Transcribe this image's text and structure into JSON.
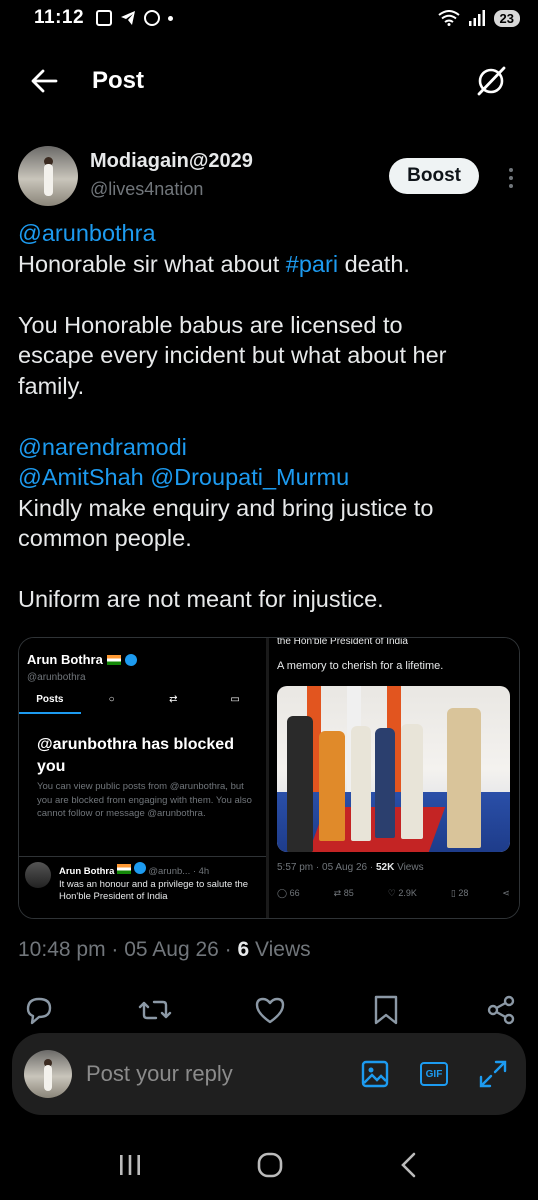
{
  "status_bar": {
    "time": "11:12",
    "battery": "23"
  },
  "header": {
    "title": "Post"
  },
  "post": {
    "display_name": "Modiagain@2029",
    "handle": "@lives4nation",
    "boost_label": "Boost",
    "text": {
      "mention_1": "@arunbothra",
      "line2_pre": "Honorable sir what about ",
      "line2_tag": "#pari",
      "line2_post": " death.",
      "line3": "You Honorable babus are licensed to",
      "line4": "escape every incident but what about her",
      "line5": "family.",
      "mention_2": "@narendramodi",
      "mention_3": "@AmitShah",
      "mention_4": "@Droupati_Murmu",
      "line8": "Kindly make enquiry and bring justice to",
      "line9": "common people.",
      "line10": "Uniform are not meant for injustice."
    },
    "timestamp": "10:48 pm · 05 Aug 26 · ",
    "views_count": "6",
    "views_label": " Views"
  },
  "media": {
    "left": {
      "name": "Arun Bothra",
      "handle": "@arunbothra",
      "tab_posts": "Posts",
      "blocked_title": "@arunbothra has blocked you",
      "blocked_text": "You can view public posts from @arunbothra, but you are blocked from engaging with them. You also cannot follow or message @arunbothra.",
      "reply_name": "Arun Bothra",
      "reply_meta": "@arunb... · 4h",
      "reply_text": "It was an honour and a privilege to salute the Hon'ble President of India"
    },
    "right": {
      "top_text": "the Hon'ble President of India",
      "caption": "A memory to cherish for a lifetime.",
      "meta_pre": "5:57 pm · 05 Aug 26 · ",
      "meta_views": "52K",
      "meta_views_label": " Views",
      "replies": "66",
      "reposts": "85",
      "likes": "2.9K",
      "bookmarks": "28"
    }
  },
  "reply_bar": {
    "placeholder": "Post your reply",
    "gif_label": "GIF"
  },
  "colors": {
    "background": "#000000",
    "accent": "#1d9bf0",
    "muted": "#71767b",
    "text": "#e7e9ea"
  }
}
